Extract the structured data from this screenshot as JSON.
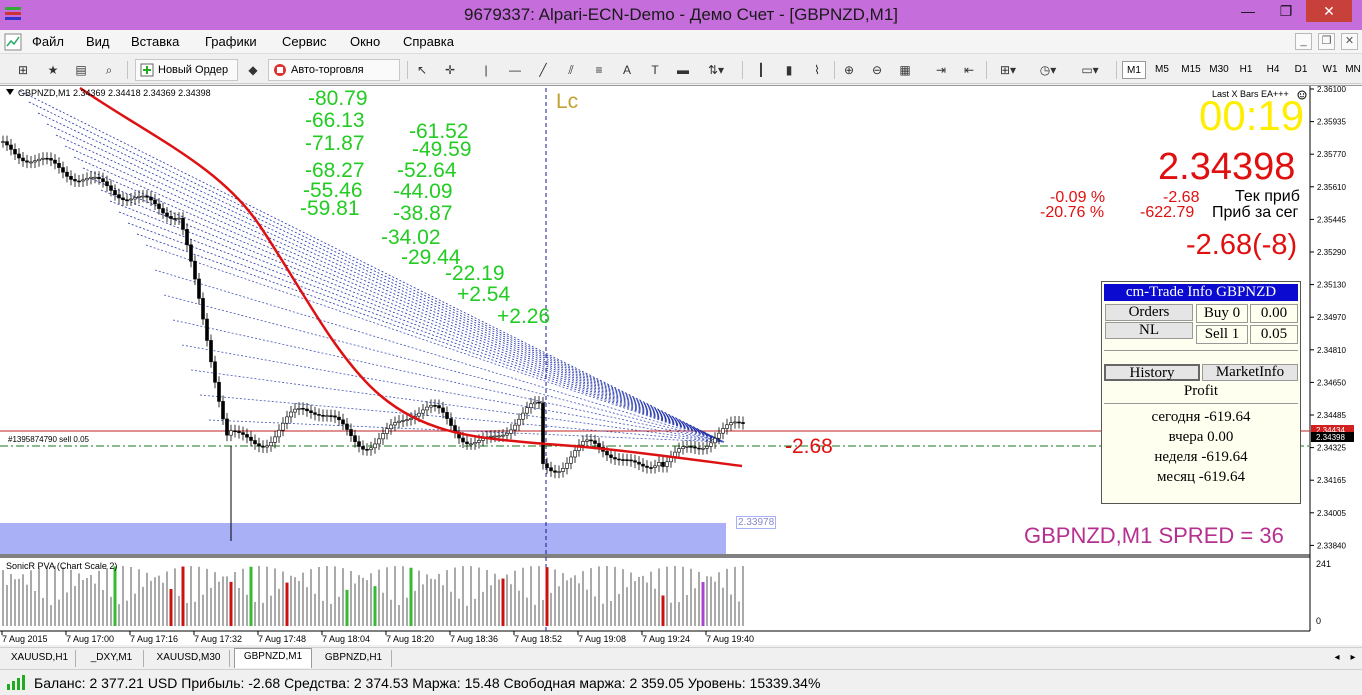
{
  "window": {
    "title": "9679337: Alpari-ECN-Demo - Демо Счет - [GBPNZD,M1]",
    "title_color": "#c46ddb"
  },
  "menu": [
    "Файл",
    "Вид",
    "Вставка",
    "Графики",
    "Сервис",
    "Окно",
    "Справка"
  ],
  "toolbar": {
    "new_order_label": "Новый Ордер",
    "autotrading_label": "Авто-торговля",
    "timeframes": [
      "M1",
      "M5",
      "M15",
      "M30",
      "H1",
      "H4",
      "D1",
      "W1",
      "MN"
    ]
  },
  "chart": {
    "header": "GBPNZD,M1  2.34369 2.34418 2.34369 2.34398",
    "ea_label": "Last X Bars EA+++",
    "timer": "00:19",
    "price_big": "2.34398",
    "pct_current": "-0.09 %",
    "pct_day": "-20.76 %",
    "profit_current": "-2.68",
    "profit_day": "-622.79",
    "label_current": "Тек приб",
    "label_day": "Приб за сег",
    "profit_summary": "-2.68(-8)",
    "order_label": "#1395874790 sell 0.05",
    "order_profit": "-2.68",
    "low_price_label": "2.33978",
    "lc_label": "Lc",
    "symbol_spread": "GBPNZD,M1    SPRED = 36",
    "indicator_label": "SonicR PVA  (Chart Scale 2)",
    "indicator_max": "241",
    "indicator_zero": "0",
    "current_price_tag": "2.34398",
    "ask_price_tag": "2.34434",
    "green_numbers": [
      "-80.79",
      "-66.13",
      "-71.87",
      "-68.27",
      "-55.46",
      "-59.81",
      "-61.52",
      "-49.59",
      "-52.64",
      "-44.09",
      "-38.87",
      "-34.02",
      "-29.44",
      "-22.19",
      "+2.54",
      "+2.26"
    ],
    "price_ticks": [
      "2.36100",
      "2.35935",
      "2.35770",
      "2.35610",
      "2.35445",
      "2.35290",
      "2.35130",
      "2.34970",
      "2.34810",
      "2.34650",
      "2.34485",
      "2.34325",
      "2.34165",
      "2.34005",
      "2.33840"
    ],
    "time_ticks": [
      "7 Aug 2015",
      "7 Aug 17:00",
      "7 Aug 17:16",
      "7 Aug 17:32",
      "7 Aug 17:48",
      "7 Aug 18:04",
      "7 Aug 18:20",
      "7 Aug 18:36",
      "7 Aug 18:52",
      "7 Aug 19:08",
      "7 Aug 19:24",
      "7 Aug 19:40"
    ]
  },
  "trade_info": {
    "title": "cm-Trade Info GBPNZD",
    "orders_label": "Orders",
    "nl_label": "NL",
    "buy_label": "Buy 0",
    "buy_value": "0.00",
    "sell_label": "Sell 1",
    "sell_value": "0.05",
    "history_label": "History",
    "marketinfo_label": "MarketInfo",
    "profit_label": "Profit",
    "today": "сегодня -619.64",
    "yesterday": "вчера 0.00",
    "week": "неделя -619.64",
    "month": "месяц -619.64"
  },
  "tabs": [
    "XAUUSD,H1",
    "_DXY,M1",
    "XAUUSD,M30",
    "GBPNZD,M1",
    "GBPNZD,H1"
  ],
  "active_tab": 3,
  "status": "Баланс: 2 377.21 USD  Прибыль: -2.68  Средства: 2 374.53  Маржа: 15.48  Свободная маржа: 2 359.05  Уровень: 15339.34%",
  "colors": {
    "green_text": "#22cc22",
    "red_text": "#e01010",
    "timer_yellow": "#ffee00",
    "spread_magenta": "#b5308f",
    "panel_header": "#0a0ad0",
    "low_zone": "#aab0f5"
  }
}
